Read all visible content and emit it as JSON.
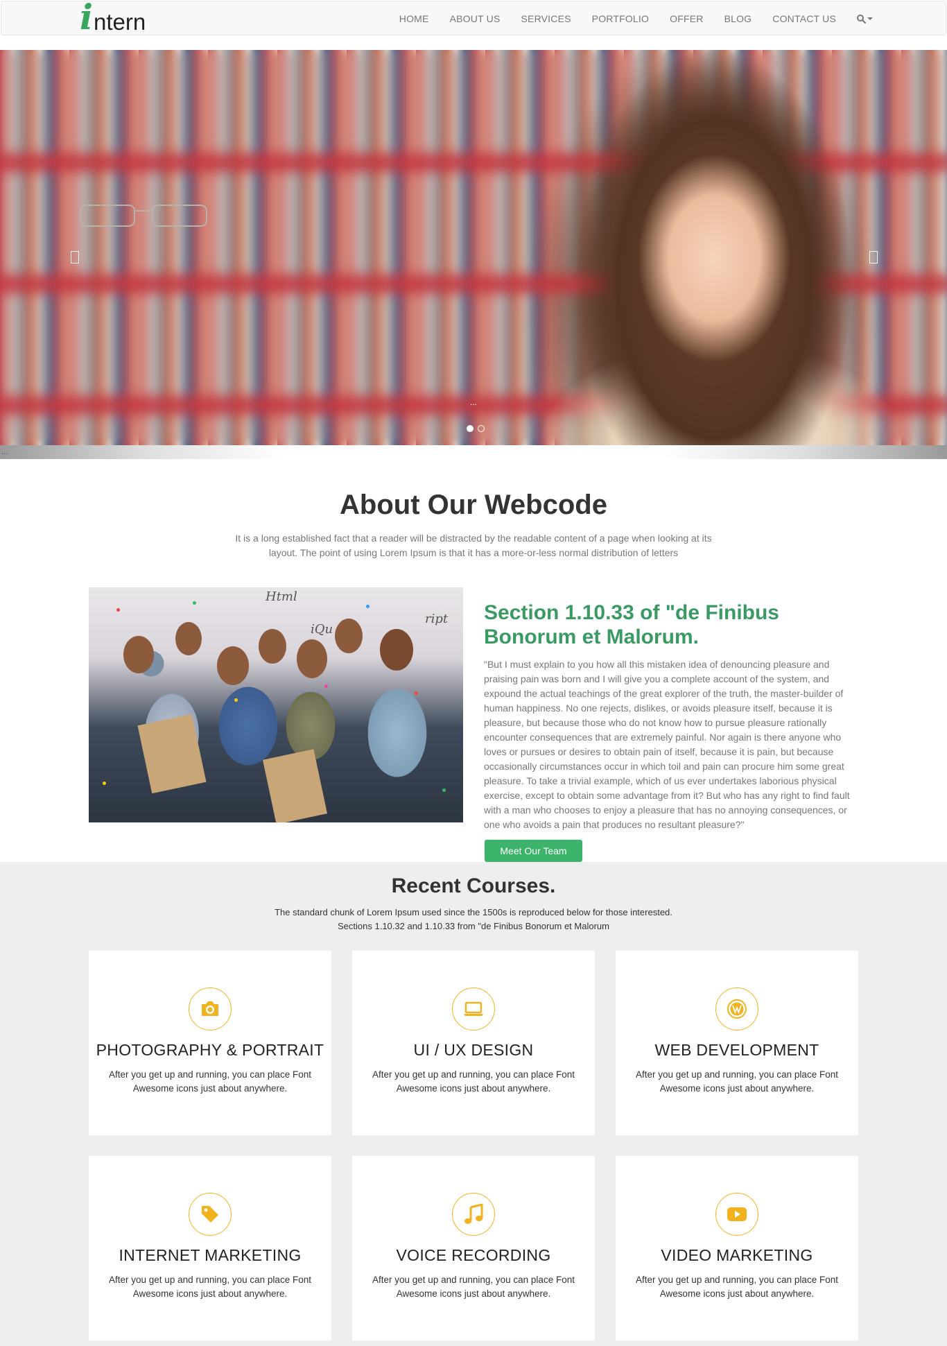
{
  "header": {
    "logo_first": "i",
    "logo_rest": "ntern",
    "nav": [
      {
        "label": "HOME"
      },
      {
        "label": "ABOUT US"
      },
      {
        "label": "SERVICES"
      },
      {
        "label": "PORTFOLIO"
      },
      {
        "label": "OFFER"
      },
      {
        "label": "BLOG"
      },
      {
        "label": "CONTACT US"
      }
    ],
    "search_icon": "search-icon"
  },
  "hero": {
    "caption": "...",
    "slide_count": 2,
    "active_slide": 1,
    "shadow_text": "..."
  },
  "about": {
    "title": "About Our Webcode",
    "intro": "It is a long established fact that a reader will be distracted by the readable content of a page when looking at its layout. The point of using Lorem Ipsum is that it has a more-or-less normal distribution of letters",
    "photo_wall_text": [
      "Html",
      "iQu",
      "ript"
    ],
    "section_heading": "Section 1.10.33 of \"de Finibus Bonorum et Malorum.",
    "section_body": "\"But I must explain to you how all this mistaken idea of denouncing pleasure and praising pain was born and I will give you a complete account of the system, and expound the actual teachings of the great explorer of the truth, the master-builder of human happiness. No one rejects, dislikes, or avoids pleasure itself, because it is pleasure, but because those who do not know how to pursue pleasure rationally encounter consequences that are extremely painful. Nor again is there anyone who loves or pursues or desires to obtain pain of itself, because it is pain, but because occasionally circumstances occur in which toil and pain can procure him some great pleasure. To take a trivial example, which of us ever undertakes laborious physical exercise, except to obtain some advantage from it? But who has any right to find fault with a man who chooses to enjoy a pleasure that has no annoying consequences, or one who avoids a pain that produces no resultant pleasure?\"",
    "button_label": "Meet Our Team"
  },
  "courses": {
    "title": "Recent Courses.",
    "subtitle_line1": "The standard chunk of Lorem Ipsum used since the 1500s is reproduced below for those interested.",
    "subtitle_line2": "Sections 1.10.32 and 1.10.33 from \"de Finibus Bonorum et Malorum",
    "accent_color": "#f2b21d",
    "items": [
      {
        "name": "PHOTOGRAPHY & PORTRAIT",
        "icon": "camera-icon",
        "desc": "After you get up and running, you can place Font Awesome icons just about anywhere."
      },
      {
        "name": "UI / UX DESIGN",
        "icon": "laptop-icon",
        "desc": "After you get up and running, you can place Font Awesome icons just about anywhere."
      },
      {
        "name": "WEB DEVELOPMENT",
        "icon": "wordpress-icon",
        "desc": "After you get up and running, you can place Font Awesome icons just about anywhere."
      },
      {
        "name": "INTERNET MARKETING",
        "icon": "tag-icon",
        "desc": "After you get up and running, you can place Font Awesome icons just about anywhere."
      },
      {
        "name": "VOICE RECORDING",
        "icon": "music-icon",
        "desc": "After you get up and running, you can place Font Awesome icons just about anywhere."
      },
      {
        "name": "VIDEO MARKETING",
        "icon": "youtube-play-icon",
        "desc": "After you get up and running, you can place Font Awesome icons just about anywhere."
      }
    ]
  },
  "colors": {
    "brand_green": "#3aa760",
    "button_green": "#3bb36a",
    "heading_green": "#3a9a63",
    "courses_bg": "#eeeeee"
  }
}
